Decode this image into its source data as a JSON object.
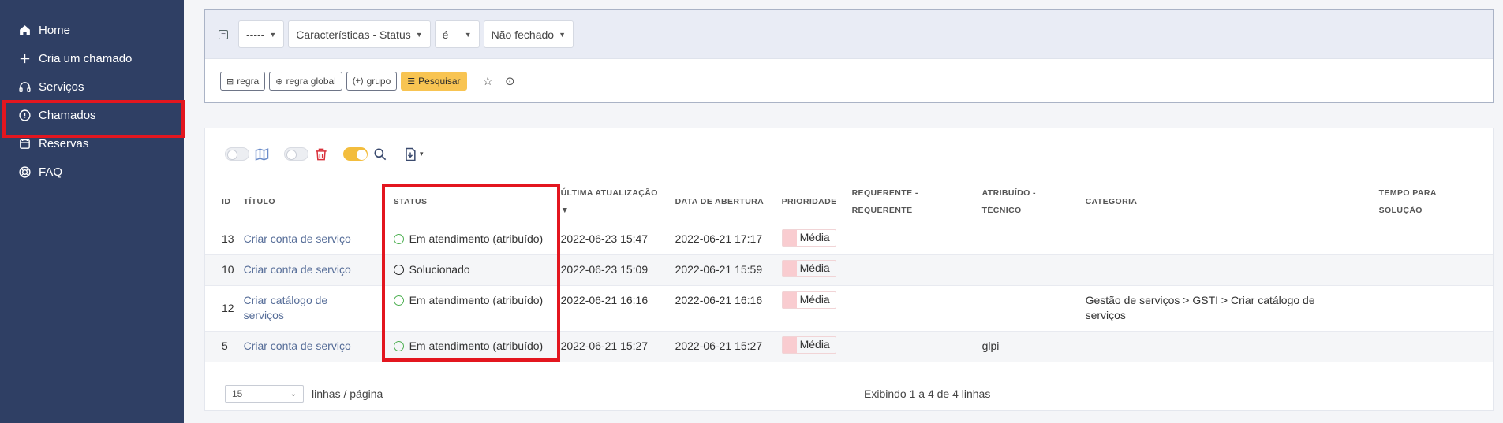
{
  "sidebar": {
    "items": [
      {
        "label": "Home",
        "icon": "home-icon"
      },
      {
        "label": "Cria um chamado",
        "icon": "plus-icon"
      },
      {
        "label": "Serviços",
        "icon": "headset-icon"
      },
      {
        "label": "Chamados",
        "icon": "alert-circle-icon",
        "highlighted": true
      },
      {
        "label": "Reservas",
        "icon": "calendar-icon"
      },
      {
        "label": "FAQ",
        "icon": "lifebuoy-icon"
      }
    ]
  },
  "search": {
    "criteria": {
      "link_select": "-----",
      "field_select": "Características - Status",
      "operator_select": "é",
      "value_select": "Não fechado"
    },
    "buttons": {
      "rule": "regra",
      "global_rule": "regra global",
      "group": "grupo",
      "search": "Pesquisar"
    }
  },
  "table": {
    "headers": {
      "id": "ID",
      "title": "TÍTULO",
      "status": "STATUS",
      "last_update": "ÚLTIMA ATUALIZAÇÃO",
      "opening_date": "DATA DE ABERTURA",
      "priority": "PRIORIDADE",
      "requester_1": "REQUERENTE -",
      "requester_2": "REQUERENTE",
      "assigned_1": "ATRIBUÍDO -",
      "assigned_2": "TÉCNICO",
      "category": "CATEGORIA",
      "solve_time_1": "TEMPO PARA",
      "solve_time_2": "SOLUÇÃO"
    },
    "rows": [
      {
        "id": "13",
        "title": "Criar conta de serviço",
        "status": "Em atendimento (atribuído)",
        "status_kind": "assigned",
        "last_update": "2022-06-23 15:47",
        "opening_date": "2022-06-21 17:17",
        "priority": "Média",
        "requester": "",
        "assigned": "",
        "category": "",
        "solve_time": ""
      },
      {
        "id": "10",
        "title": "Criar conta de serviço",
        "status": "Solucionado",
        "status_kind": "solved",
        "last_update": "2022-06-23 15:09",
        "opening_date": "2022-06-21 15:59",
        "priority": "Média",
        "requester": "",
        "assigned": "",
        "category": "",
        "solve_time": ""
      },
      {
        "id": "12",
        "title_1": "Criar catálogo de",
        "title_2": "serviços",
        "status": "Em atendimento (atribuído)",
        "status_kind": "assigned",
        "last_update": "2022-06-21 16:16",
        "opening_date": "2022-06-21 16:16",
        "priority": "Média",
        "requester": "",
        "assigned": "",
        "category_1": "Gestão de serviços > GSTI > Criar catálogo de",
        "category_2": "serviços",
        "solve_time": ""
      },
      {
        "id": "5",
        "title": "Criar conta de serviço",
        "status": "Em atendimento (atribuído)",
        "status_kind": "assigned",
        "last_update": "2022-06-21 15:27",
        "opening_date": "2022-06-21 15:27",
        "priority": "Média",
        "requester": "",
        "assigned": "glpi",
        "category": "",
        "solve_time": ""
      }
    ]
  },
  "footer": {
    "page_size": "15",
    "per_page_label": "linhas / página",
    "showing": "Exibindo 1 a 4 de 4 linhas"
  },
  "colors": {
    "sidebar_bg": "#2f3f64",
    "highlight": "#e3161f",
    "search_button": "#f8c452",
    "status_assigned": "#4caf50",
    "priority_medium": "#f9ccd0"
  }
}
